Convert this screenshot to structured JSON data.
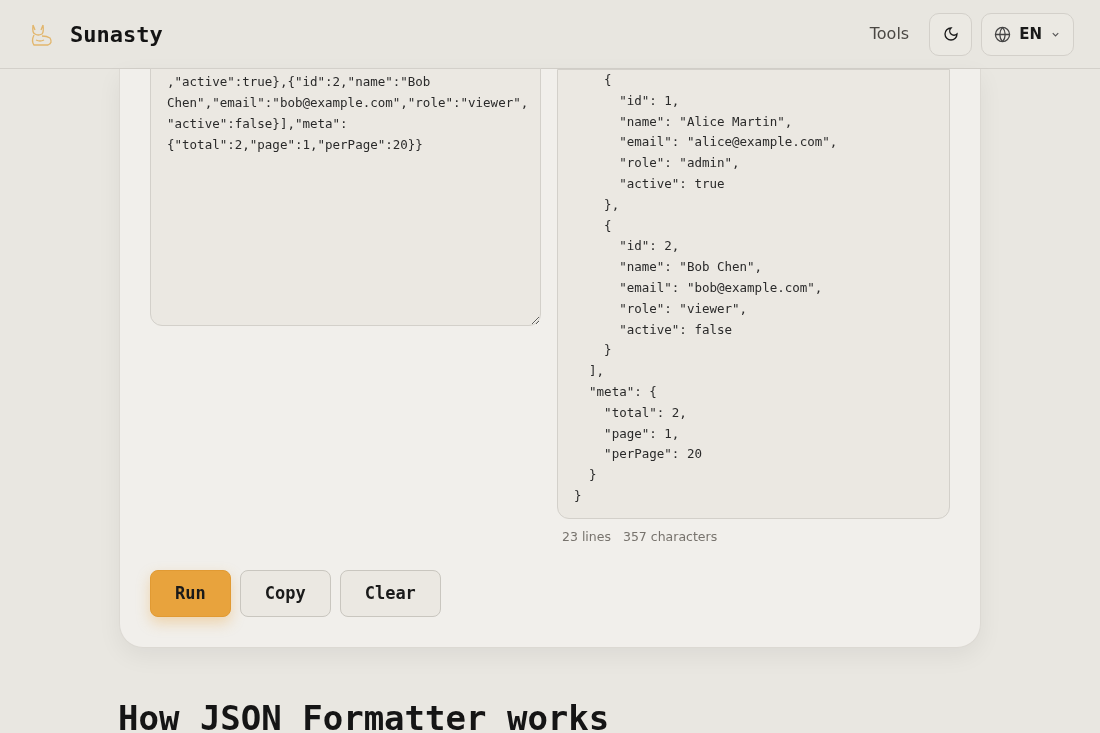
{
  "header": {
    "brand": "Sunasty",
    "nav_link": "Tools",
    "language": "EN"
  },
  "formatter": {
    "input": ",\"active\":true},{\"id\":2,\"name\":\"Bob Chen\",\"email\":\"bob@example.com\",\"role\":\"viewer\",\"active\":false}],\"meta\":{\"total\":2,\"page\":1,\"perPage\":20}}",
    "output_lines": [
      "    {",
      "      \"id\": 1,",
      "      \"name\": \"Alice Martin\",",
      "      \"email\": \"alice@example.com\",",
      "      \"role\": \"admin\",",
      "      \"active\": true",
      "    },",
      "    {",
      "      \"id\": 2,",
      "      \"name\": \"Bob Chen\",",
      "      \"email\": \"bob@example.com\",",
      "      \"role\": \"viewer\",",
      "      \"active\": false",
      "    }",
      "  ],",
      "  \"meta\": {",
      "    \"total\": 2,",
      "    \"page\": 1,",
      "    \"perPage\": 20",
      "  }",
      "}"
    ],
    "stats": [
      "23 lines",
      "357 characters"
    ],
    "buttons": [
      {
        "label": "Run",
        "kind": "primary"
      },
      {
        "label": "Copy",
        "kind": "secondary"
      },
      {
        "label": "Clear",
        "kind": "secondary"
      }
    ]
  },
  "section_heading": "How JSON Formatter works"
}
